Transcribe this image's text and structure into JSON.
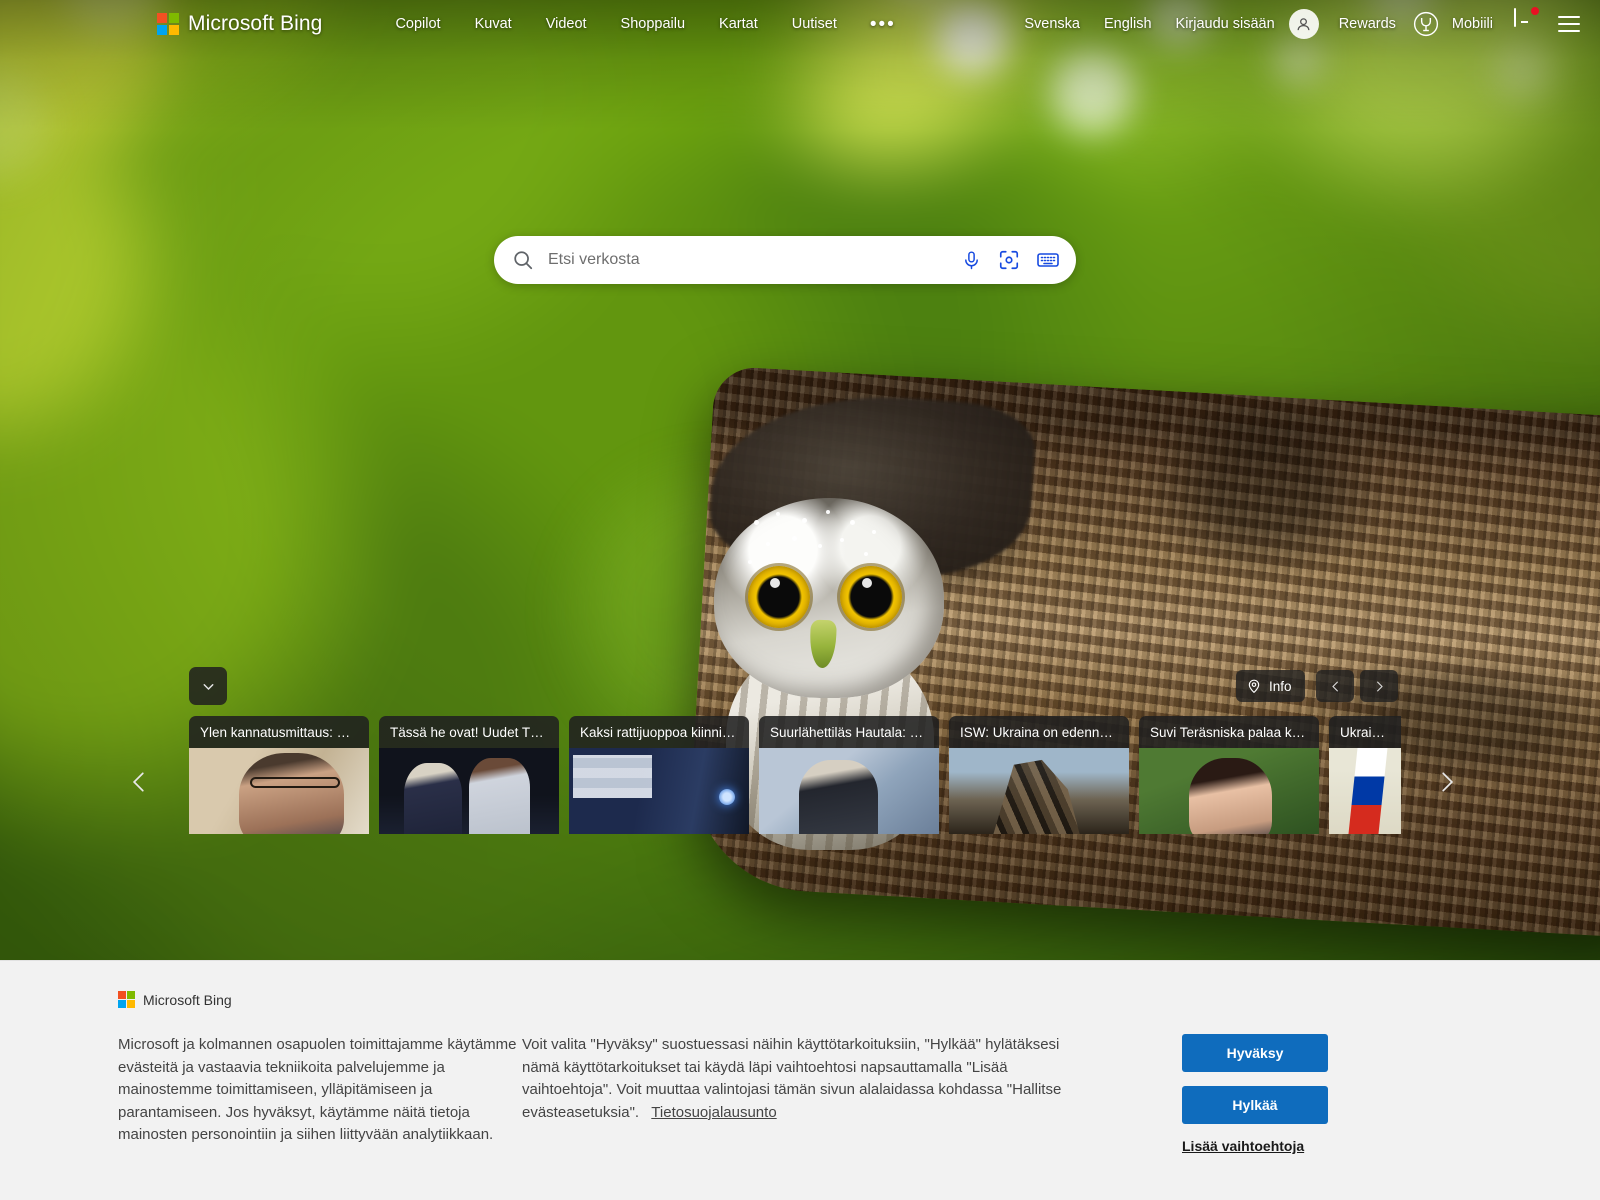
{
  "header": {
    "brand": "Microsoft Bing",
    "nav": [
      {
        "label": "Copilot"
      },
      {
        "label": "Kuvat"
      },
      {
        "label": "Videot"
      },
      {
        "label": "Shoppailu"
      },
      {
        "label": "Kartat"
      },
      {
        "label": "Uutiset"
      }
    ],
    "overflow": "•••",
    "lang_sv": "Svenska",
    "lang_en": "English",
    "signin": "Kirjaudu sisään",
    "rewards": "Rewards",
    "mobile": "Mobiili",
    "icons": {
      "avatar": "person-icon",
      "rewards": "rewards-medal-icon",
      "mobile": "mobile-phone-icon",
      "menu": "hamburger-menu-icon"
    }
  },
  "search": {
    "placeholder": "Etsi verkosta",
    "value": "",
    "icons": {
      "search": "search-icon",
      "mic": "microphone-icon",
      "lens": "visual-search-icon",
      "keyboard": "keyboard-icon"
    }
  },
  "carousel": {
    "collapse_icon": "chevron-down-icon",
    "info_label": "Info",
    "info_icon": "location-pin-icon",
    "prev_icon": "chevron-left-icon",
    "next_icon": "chevron-right-icon",
    "cards": [
      {
        "title": "Ylen kannatusmittaus: Ko…",
        "thumb": "t1"
      },
      {
        "title": "Tässä he ovat! Uudet TTK…",
        "thumb": "t2"
      },
      {
        "title": "Kaksi rattijuoppoa kiinni H…",
        "thumb": "t3"
      },
      {
        "title": "Suurlähettiläs Hautala: Ka…",
        "thumb": "t4"
      },
      {
        "title": "ISW: Ukraina on edennyt …",
        "thumb": "t5"
      },
      {
        "title": "Suvi Teräsniska palaa keik…",
        "thumb": "t6"
      },
      {
        "title": "Ukraina py",
        "thumb": "t7"
      }
    ]
  },
  "consent": {
    "brand": "Microsoft Bing",
    "paragraph1": "Microsoft ja kolmannen osapuolen toimittajamme käytämme evästeitä ja vastaavia tekniikoita palvelujemme ja mainostemme toimittamiseen, ylläpitämiseen ja parantamiseen. Jos hyväksyt, käytämme näitä tietoja mainosten personointiin ja siihen liittyvään analytiikkaan.",
    "paragraph2": "Voit valita \"Hyväksy\" suostuessasi näihin käyttötarkoituksiin, \"Hylkää\" hylätäksesi nämä käyttötarkoitukset tai käydä läpi vaihtoehtosi napsauttamalla \"Lisää vaihtoehtoja\". Voit muuttaa valintojasi tämän sivun alalaidassa kohdassa \"Hallitse evästeasetuksia\".",
    "privacy_link": "Tietosuojalausunto",
    "accept": "Hyväksy",
    "reject": "Hylkää",
    "more_options": "Lisää vaihtoehtoja"
  },
  "colors": {
    "accent_blue": "#0f6cbd",
    "ms_red": "#f25022",
    "ms_green": "#7fba00",
    "ms_blue": "#00a4ef",
    "ms_yellow": "#ffb900",
    "consent_bg": "#f2f2f2",
    "search_icon_blue": "#174ae0"
  }
}
